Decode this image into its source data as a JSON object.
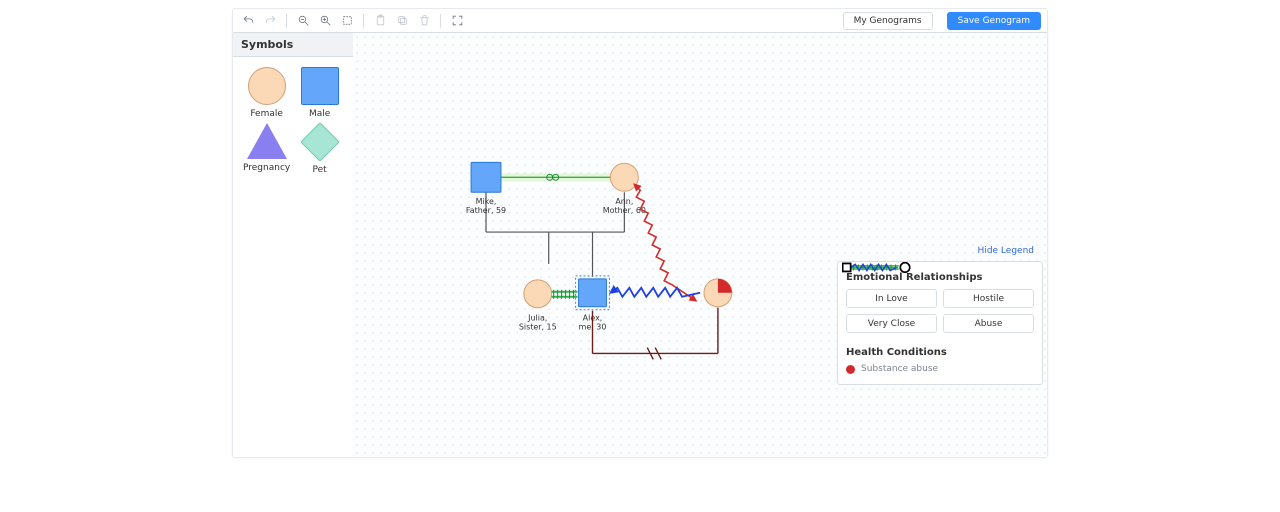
{
  "toolbar": {
    "my_genograms": "My Genograms",
    "save": "Save Genogram"
  },
  "sidebar": {
    "title": "Symbols",
    "items": [
      {
        "label": "Female",
        "kind": "female"
      },
      {
        "label": "Male",
        "kind": "male"
      },
      {
        "label": "Pregnancy",
        "kind": "pregnancy"
      },
      {
        "label": "Pet",
        "kind": "pet"
      }
    ]
  },
  "nodes": {
    "mike": {
      "line1": "Mike,",
      "line2": "Father, 59"
    },
    "ann": {
      "line1": "Ann,",
      "line2": "Mother, 60"
    },
    "julia": {
      "line1": "Julia,",
      "line2": "Sister, 15"
    },
    "alex": {
      "line1": "Alex,",
      "line2": "me, 30"
    }
  },
  "legend": {
    "hide": "Hide Legend",
    "section1": "Emotional Relationships",
    "cards": [
      {
        "label": "In Love"
      },
      {
        "label": "Hostile"
      },
      {
        "label": "Very Close"
      },
      {
        "label": "Abuse"
      }
    ],
    "section2": "Health Conditions",
    "health_item": "Substance abuse"
  }
}
